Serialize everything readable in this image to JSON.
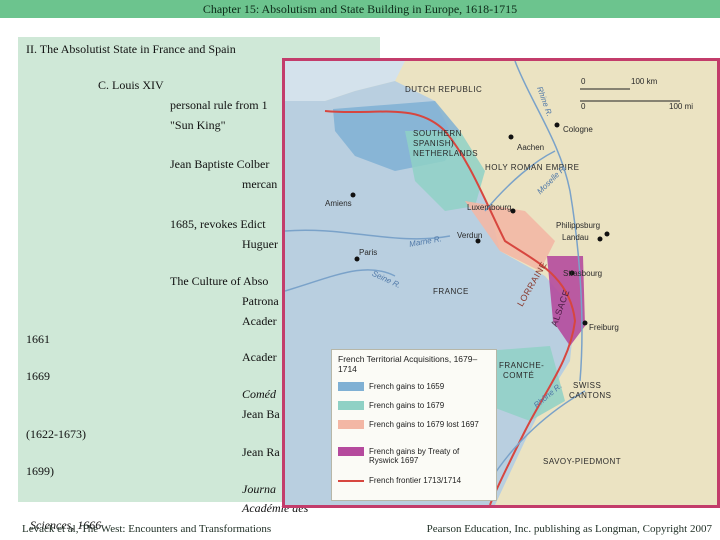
{
  "header": {
    "title": "Chapter 15: Absolutism and State Building in Europe, 1618-1715"
  },
  "outline": {
    "section": "II. The Absolutist State in France and Spain",
    "subsection": "C. Louis XIV",
    "personal_rule": "personal rule from 1",
    "sun_king": "\"Sun King\"",
    "colbert": "Jean Baptiste Colber",
    "mercantilism": "mercan",
    "edict": "1685, revokes Edict",
    "huguenots": "Huguer",
    "culture": "The Culture of Abso",
    "patronage": "Patrona",
    "academy1": "Acader",
    "year_1661": "1661",
    "academy2": "Acader",
    "year_1669": "1669",
    "comedie": "Coméd",
    "jean_ba": "Jean Ba",
    "moliere_years": "(1622-1673)",
    "jean_ra": "Jean Ra",
    "racine_end": "1699)",
    "journal": "Journa",
    "academie_des": "Académie des",
    "sciences": "Sciences, 1666"
  },
  "map": {
    "labels": {
      "dutch_republic": "DUTCH REPUBLIC",
      "rhine": "Rhine R.",
      "southern_netherlands_1": "SOUTHERN",
      "southern_netherlands_2": "SPANISH)",
      "southern_netherlands_3": "NETHERLANDS",
      "aachen": "Aachen",
      "cologne": "Cologne",
      "hre": "HOLY ROMAN EMPIRE",
      "amiens": "Amiens",
      "luxembourg": "Luxembourg",
      "moselle": "Moselle R.",
      "philippsburg": "Philippsburg",
      "landau": "Landau",
      "verdun": "Verdun",
      "paris": "Paris",
      "marne": "Marne R.",
      "seine": "Seine R.",
      "lorraine": "LORRAINE",
      "strasbourg": "Strasbourg",
      "france": "FRANCE",
      "alsace": "ALSACE",
      "freiburg": "Freiburg",
      "franche_comte_1": "FRANCHE-",
      "franche_comte_2": "COMTÉ",
      "swiss_1": "SWISS",
      "swiss_2": "CANTONS",
      "savoy": "SAVOY-PIEDMONT",
      "rhone": "Rhône R."
    },
    "scale": {
      "zero_top": "0",
      "km": "100 km",
      "zero_bottom": "0",
      "mi": "100 mi"
    },
    "legend": {
      "title": "French Territorial Acquisitions, 1679–1714",
      "items": [
        {
          "label": "French gains to 1659",
          "color": "#7fb0d4"
        },
        {
          "label": "French gains to 1679",
          "color": "#8fd1c5"
        },
        {
          "label": "French gains to 1679 lost 1697",
          "color": "#f3b7a5"
        },
        {
          "label": "French gains by Treaty of Ryswick 1697",
          "color": "#b54a9d"
        },
        {
          "label": "French frontier 1713/1714",
          "color": "#d7463f"
        }
      ]
    },
    "colors": {
      "land": "#ebe3c2",
      "water": "#d4e2ec",
      "france": "#b9cfe0",
      "frontier": "#d7463f",
      "border_frame": "#c33c6b"
    }
  },
  "footer": {
    "left": "Levack et al, The West: Encounters and Transformations",
    "right": "Pearson Education, Inc. publishing as Longman, Copyright 2007"
  }
}
